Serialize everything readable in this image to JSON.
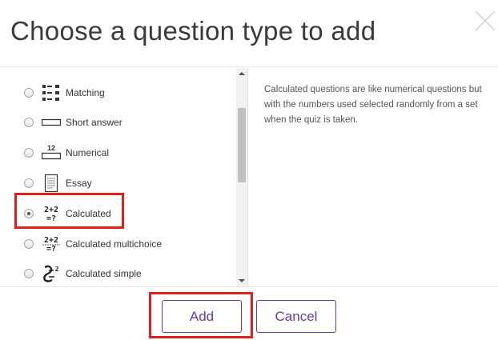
{
  "dialog": {
    "title": "Choose a question type to add"
  },
  "question_types": [
    {
      "label": "Matching",
      "icon": "matching-icon",
      "selected": false
    },
    {
      "label": "Short answer",
      "icon": "short-answer-icon",
      "selected": false
    },
    {
      "label": "Numerical",
      "icon": "numerical-icon",
      "selected": false
    },
    {
      "label": "Essay",
      "icon": "essay-icon",
      "selected": false
    },
    {
      "label": "Calculated",
      "icon": "calculated-icon",
      "selected": true
    },
    {
      "label": "Calculated multichoice",
      "icon": "calculated-multichoice-icon",
      "selected": false
    },
    {
      "label": "Calculated simple",
      "icon": "calculated-simple-icon",
      "selected": false
    }
  ],
  "icon_text": {
    "numerical": "12",
    "calculated_top": "2+2",
    "calculated_bottom": "=?",
    "calculated_simple": "2"
  },
  "description": "Calculated questions are like numerical questions but with the numbers used selected randomly from a set when the quiz is taken.",
  "buttons": {
    "add": "Add",
    "cancel": "Cancel"
  },
  "colors": {
    "button_accent": "#6a3aa3",
    "highlight": "#e0201d"
  }
}
